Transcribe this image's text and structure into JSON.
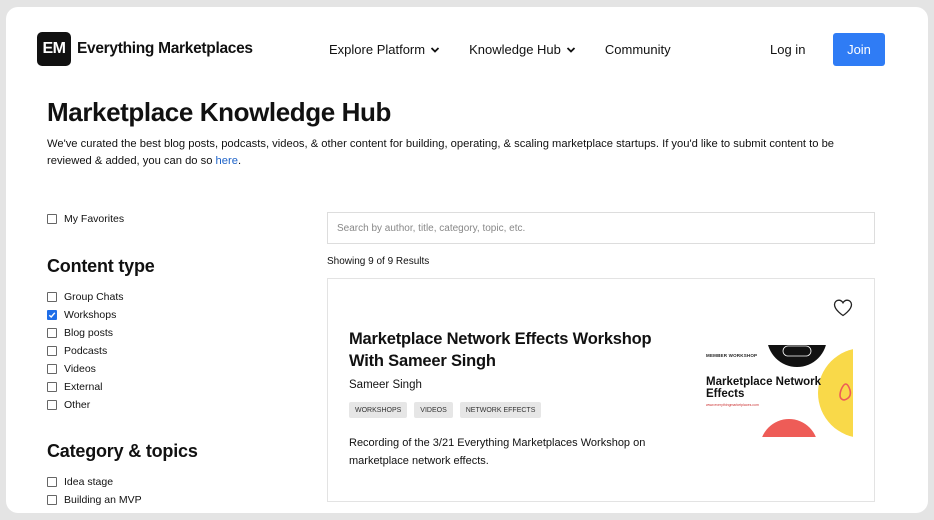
{
  "header": {
    "logo_mark": "EM",
    "logo_text": "Everything Marketplaces",
    "nav": [
      {
        "label": "Explore Platform",
        "has_dropdown": true
      },
      {
        "label": "Knowledge Hub",
        "has_dropdown": true
      },
      {
        "label": "Community",
        "has_dropdown": false
      }
    ],
    "login_label": "Log in",
    "join_label": "Join",
    "join_color": "#2f7cf5"
  },
  "hero": {
    "title": "Marketplace Knowledge Hub",
    "intro_text": "We've curated the best blog posts, podcasts, videos, & other content for building, operating, & scaling marketplace startups. If you'd like to submit content to be reviewed & added, you can do so ",
    "intro_link": "here",
    "intro_end": "."
  },
  "sidebar": {
    "favorites": {
      "label": "My Favorites",
      "checked": false
    },
    "content_type_title": "Content type",
    "content_types": [
      {
        "label": "Group Chats",
        "checked": false
      },
      {
        "label": "Workshops",
        "checked": true
      },
      {
        "label": "Blog posts",
        "checked": false
      },
      {
        "label": "Podcasts",
        "checked": false
      },
      {
        "label": "Videos",
        "checked": false
      },
      {
        "label": "External",
        "checked": false
      },
      {
        "label": "Other",
        "checked": false
      }
    ],
    "category_title": "Category & topics",
    "categories": [
      {
        "label": "Idea stage",
        "checked": false
      },
      {
        "label": "Building an MVP",
        "checked": false
      }
    ]
  },
  "main": {
    "search_placeholder": "Search by author, title, category, topic, etc.",
    "results_count": "Showing 9 of 9 Results",
    "card": {
      "title": "Marketplace Network Effects Workshop With Sameer Singh",
      "author": "Sameer Singh",
      "tags": [
        "WORKSHOPS",
        "VIDEOS",
        "NETWORK EFFECTS"
      ],
      "description": "Recording of the 3/21 Everything Marketplaces Workshop on marketplace network effects.",
      "favorite_icon": "heart-outline-icon",
      "thumbnail": {
        "kicker": "MEMBER WORKSHOP",
        "title": "Marketplace Network Effects",
        "url": "www.everythingmarketplaces.com",
        "accent_yellow": "#f9d949",
        "accent_red": "#ee5c57",
        "accent_black": "#111111"
      }
    }
  }
}
